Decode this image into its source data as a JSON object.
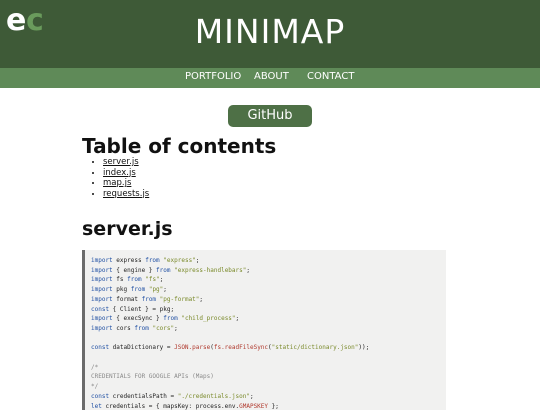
{
  "header": {
    "logo_text": "ec",
    "title": "MINIMAP"
  },
  "nav": {
    "items": [
      {
        "label": "PORTFOLIO"
      },
      {
        "label": "ABOUT"
      },
      {
        "label": "CONTACT"
      }
    ]
  },
  "main": {
    "github_label": "GitHub",
    "toc_title": "Table of contents",
    "toc_items": [
      "server.js",
      "index.js",
      "map.js",
      "requests.js"
    ],
    "section_title": "server.js"
  },
  "code": {
    "lines": [
      "import express from \"express\";",
      "import { engine } from \"express-handlebars\";",
      "import fs from \"fs\";",
      "import pkg from \"pg\";",
      "import format from \"pg-format\";",
      "const { Client } = pkg;",
      "import { execSync } from \"child_process\";",
      "import cors from \"cors\";",
      "",
      "const dataDictionary = JSON.parse(fs.readFileSync(\"static/dictionary.json\"));",
      "",
      "/*",
      "CREDENTIALS FOR GOOGLE APIs (Maps)",
      "*/",
      "const credentialsPath = \"./credentials.json\";",
      "let credentials = { mapsKey: process.env.GMAPSKEY };"
    ]
  },
  "colors": {
    "header_bg": "#3e5a37",
    "nav_bg": "#5f8a58",
    "button_bg": "#4e7046",
    "code_bg": "#f1f1f0"
  }
}
